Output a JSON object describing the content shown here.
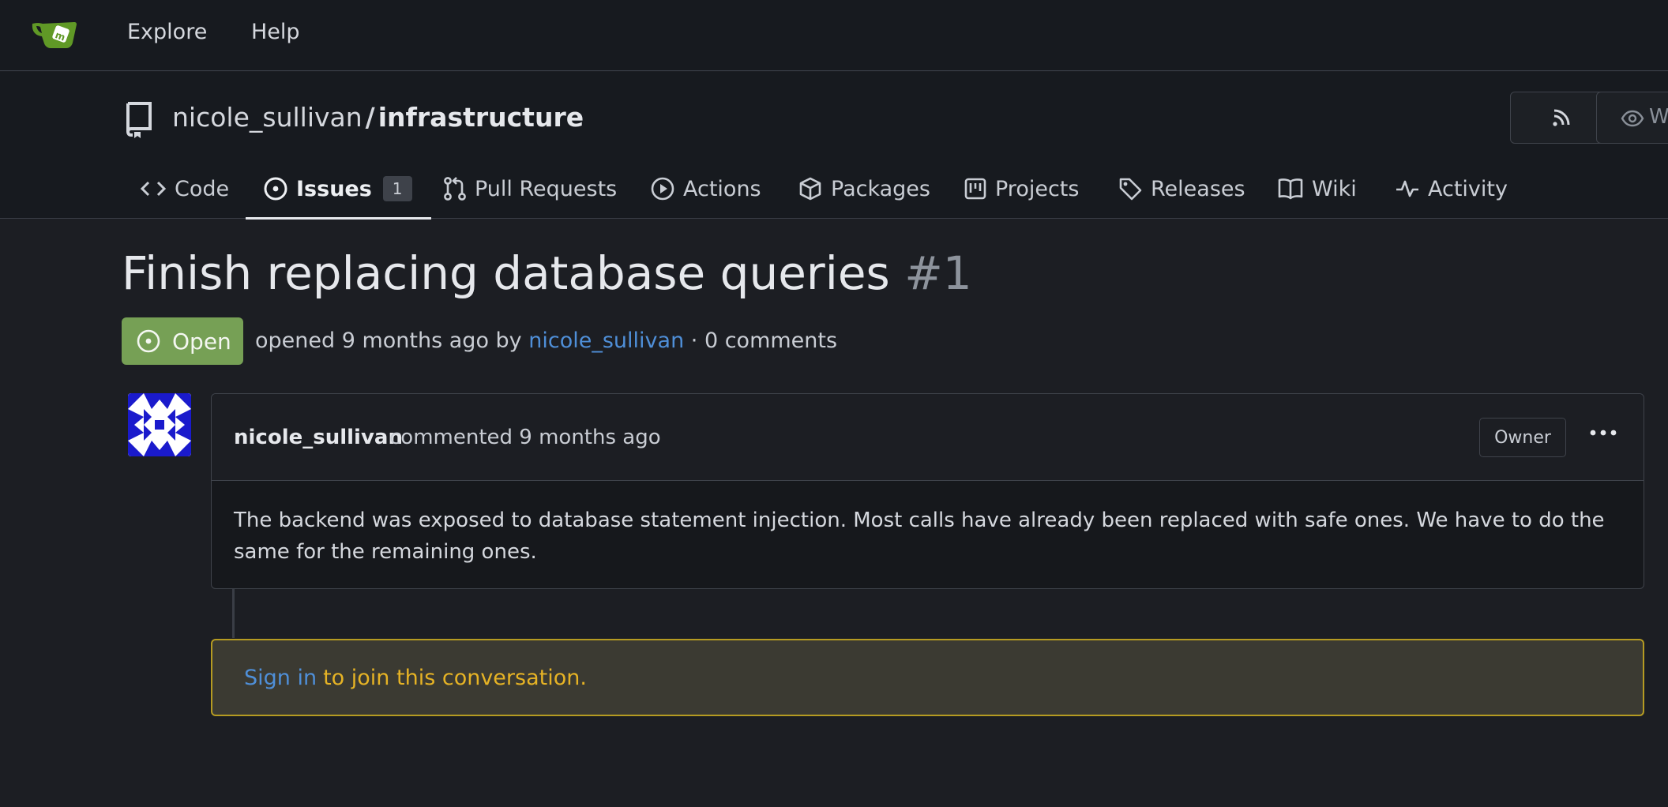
{
  "nav": {
    "items": [
      "Explore",
      "Help"
    ]
  },
  "repo": {
    "owner": "nicole_sullivan",
    "separator": "/",
    "name": "infrastructure",
    "watch_label": "W"
  },
  "tabs": [
    {
      "label": "Code",
      "icon": "code-icon"
    },
    {
      "label": "Issues",
      "icon": "issue-icon",
      "count": "1",
      "active": true
    },
    {
      "label": "Pull Requests",
      "icon": "pull-request-icon"
    },
    {
      "label": "Actions",
      "icon": "play-icon"
    },
    {
      "label": "Packages",
      "icon": "package-icon"
    },
    {
      "label": "Projects",
      "icon": "project-icon"
    },
    {
      "label": "Releases",
      "icon": "tag-icon"
    },
    {
      "label": "Wiki",
      "icon": "book-icon"
    },
    {
      "label": "Activity",
      "icon": "pulse-icon"
    }
  ],
  "issue": {
    "title": "Finish replacing database queries",
    "number": "#1",
    "status": "Open",
    "meta_prefix": "opened 9 months ago by",
    "author": "nicole_sullivan",
    "meta_suffix": "· 0 comments"
  },
  "comment": {
    "author": "nicole_sullivan",
    "when": "commented 9 months ago",
    "role_badge": "Owner",
    "body": "The backend was exposed to database statement injection. Most calls have already been replaced with safe ones. We have to do the same for the remaining ones."
  },
  "signin_notice": {
    "link": "Sign in",
    "text": "to join this conversation."
  },
  "colors": {
    "accent_link": "#4f8fd8",
    "open_badge": "#76a055",
    "notice_border": "#b59b22",
    "notice_text": "#e6b325",
    "logo_green": "#609926"
  }
}
